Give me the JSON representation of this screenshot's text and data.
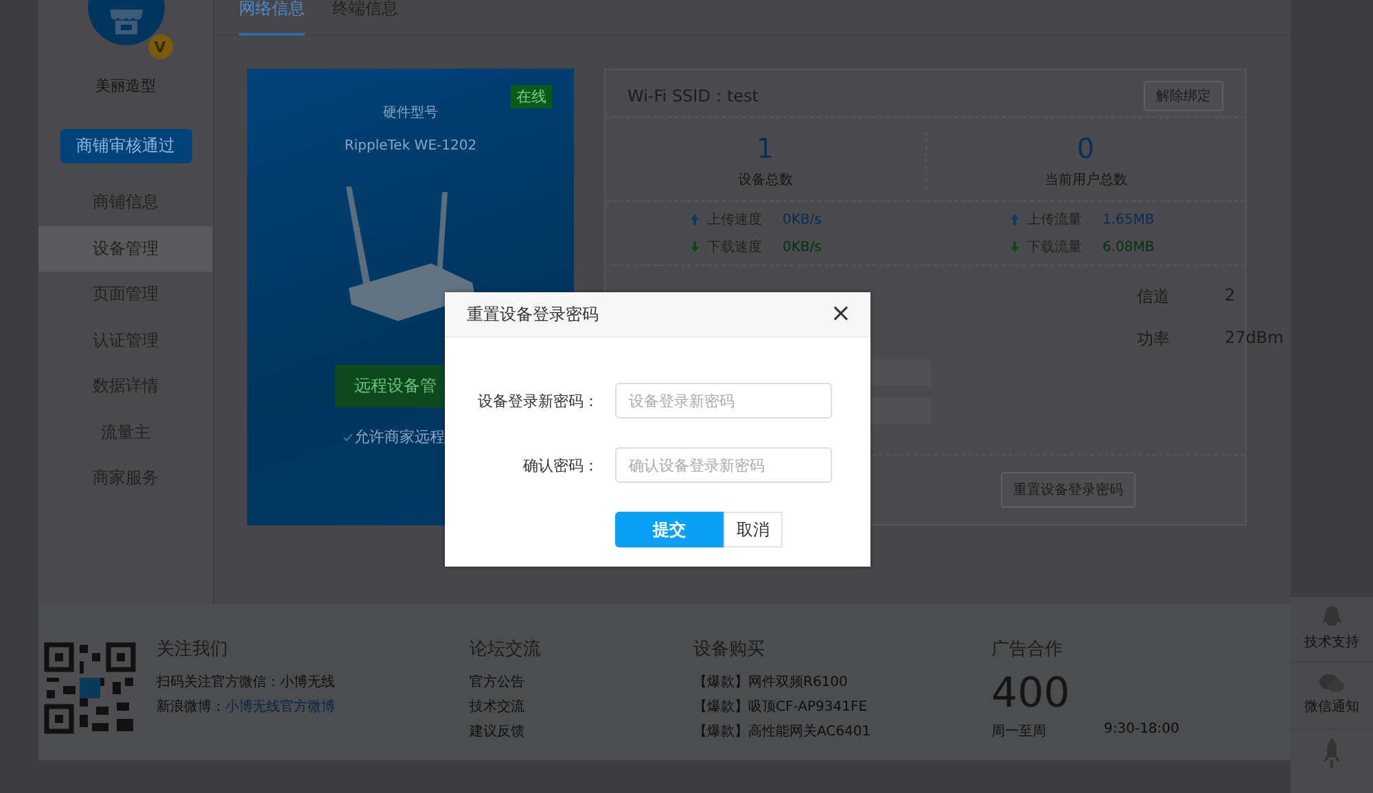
{
  "sidebar": {
    "shop_name": "美丽造型",
    "badge": "V",
    "status_button": "商铺审核通过",
    "items": [
      {
        "label": "商铺信息",
        "selected": false
      },
      {
        "label": "设备管理",
        "selected": true
      },
      {
        "label": "页面管理",
        "selected": false
      },
      {
        "label": "认证管理",
        "selected": false
      },
      {
        "label": "数据详情",
        "selected": false
      },
      {
        "label": "流量主",
        "selected": false
      },
      {
        "label": "商家服务",
        "selected": false
      }
    ]
  },
  "tabs": [
    {
      "label": "网络信息",
      "selected": true
    },
    {
      "label": "终端信息",
      "selected": false
    }
  ],
  "device_card": {
    "status": "在线",
    "model_label": "硬件型号",
    "model": "RippleTek WE-1202",
    "remote_button": "远程设备管",
    "allow_remote": {
      "checked": true,
      "label": "允许商家远程"
    }
  },
  "network_card": {
    "ssid": "Wi-Fi SSID：test",
    "unbind_button": "解除绑定",
    "stats": [
      {
        "value": "1",
        "label": "设备总数"
      },
      {
        "value": "0",
        "label": "当前用户总数"
      }
    ],
    "rate_groups": [
      [
        {
          "kind": "up",
          "label": "上传速度",
          "value": "0KB/s"
        },
        {
          "kind": "down",
          "label": "下载速度",
          "value": "0KB/s"
        }
      ],
      [
        {
          "kind": "up",
          "label": "上传流量",
          "value": "1.65MB"
        },
        {
          "kind": "down",
          "label": "下载流量",
          "value": "6.08MB"
        }
      ]
    ],
    "details": [
      {
        "label": "信道",
        "value": "2"
      },
      {
        "label": "功率",
        "value": "27dBm"
      }
    ],
    "reset_button": "重置设备登录密码"
  },
  "dialog": {
    "title": "重置设备登录密码",
    "close": "×",
    "fields": [
      {
        "label": "设备登录新密码：",
        "placeholder": "设备登录新密码"
      },
      {
        "label": "确认密码：",
        "placeholder": "确认设备登录新密码"
      }
    ],
    "submit": "提交",
    "cancel": "取消"
  },
  "footer": {
    "follow": {
      "title": "关注我们",
      "wechat": "扫码关注官方微信：小博无线",
      "weibo_label": "新浪微博：",
      "weibo_link": "小博无线官方微博"
    },
    "forum": {
      "title": "论坛交流",
      "links": [
        "官方公告",
        "技术交流",
        "建议反馈"
      ]
    },
    "purchase": {
      "title": "设备购买",
      "links": [
        "【爆款】网件双频R6100",
        "【爆款】吸顶CF-AP9341FE",
        "【爆款】高性能网关AC6401"
      ]
    },
    "ads": {
      "title": "广告合作",
      "phone": "400",
      "hours_start": "周一至周",
      "hours_end": "9:30-18:00"
    }
  },
  "float_panel": [
    {
      "label": "技术支持"
    },
    {
      "label": "微信通知"
    }
  ]
}
